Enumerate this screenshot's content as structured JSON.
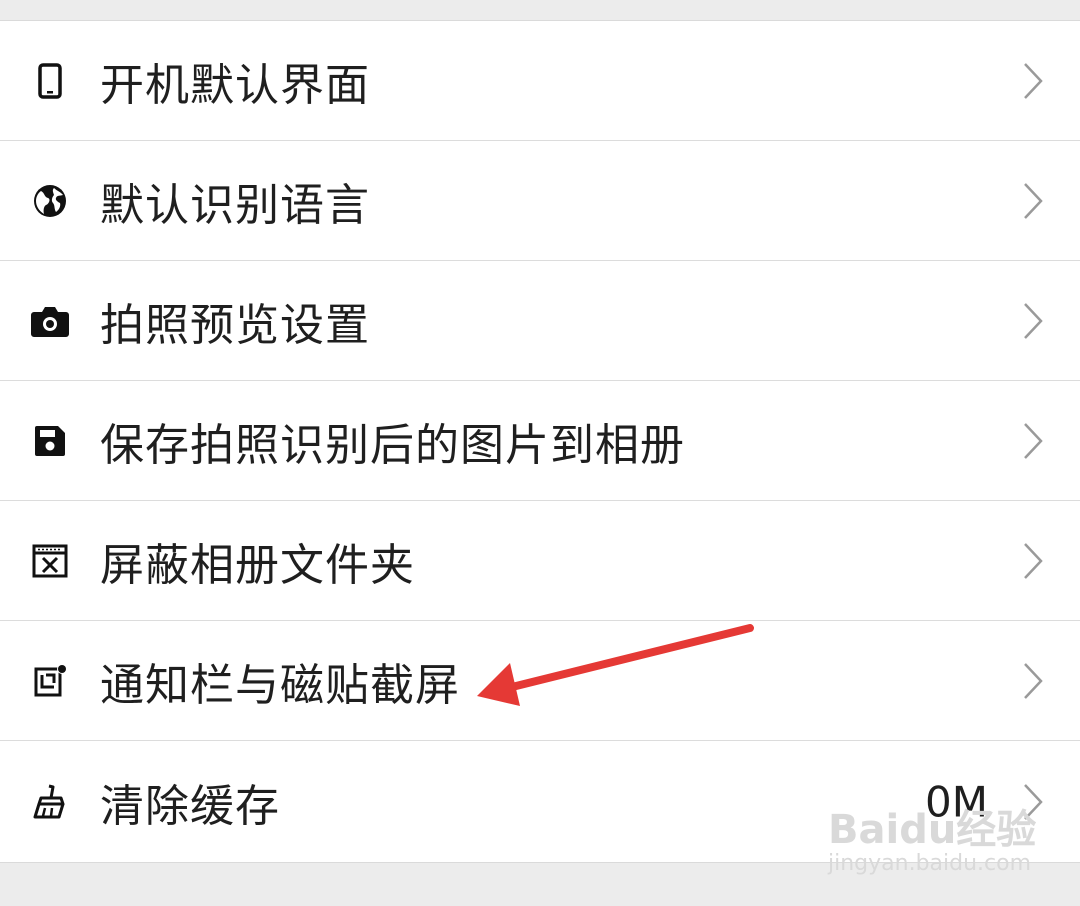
{
  "settings": {
    "items": [
      {
        "icon": "phone-icon",
        "label": "开机默认界面",
        "value": ""
      },
      {
        "icon": "globe-icon",
        "label": "默认识别语言",
        "value": ""
      },
      {
        "icon": "camera-icon",
        "label": "拍照预览设置",
        "value": ""
      },
      {
        "icon": "save-icon",
        "label": "保存拍照识别后的图片到相册",
        "value": ""
      },
      {
        "icon": "hide-folder-icon",
        "label": "屏蔽相册文件夹",
        "value": ""
      },
      {
        "icon": "screenshot-icon",
        "label": "通知栏与磁贴截屏",
        "value": ""
      },
      {
        "icon": "broom-icon",
        "label": "清除缓存",
        "value": "0M"
      }
    ]
  },
  "watermark": {
    "brand": "Baidu经验",
    "url": "jingyan.baidu.com"
  },
  "colors": {
    "arrow": "#e53935",
    "text": "#1f1f1f",
    "divider": "#dcdcdc",
    "background": "#ececec"
  }
}
